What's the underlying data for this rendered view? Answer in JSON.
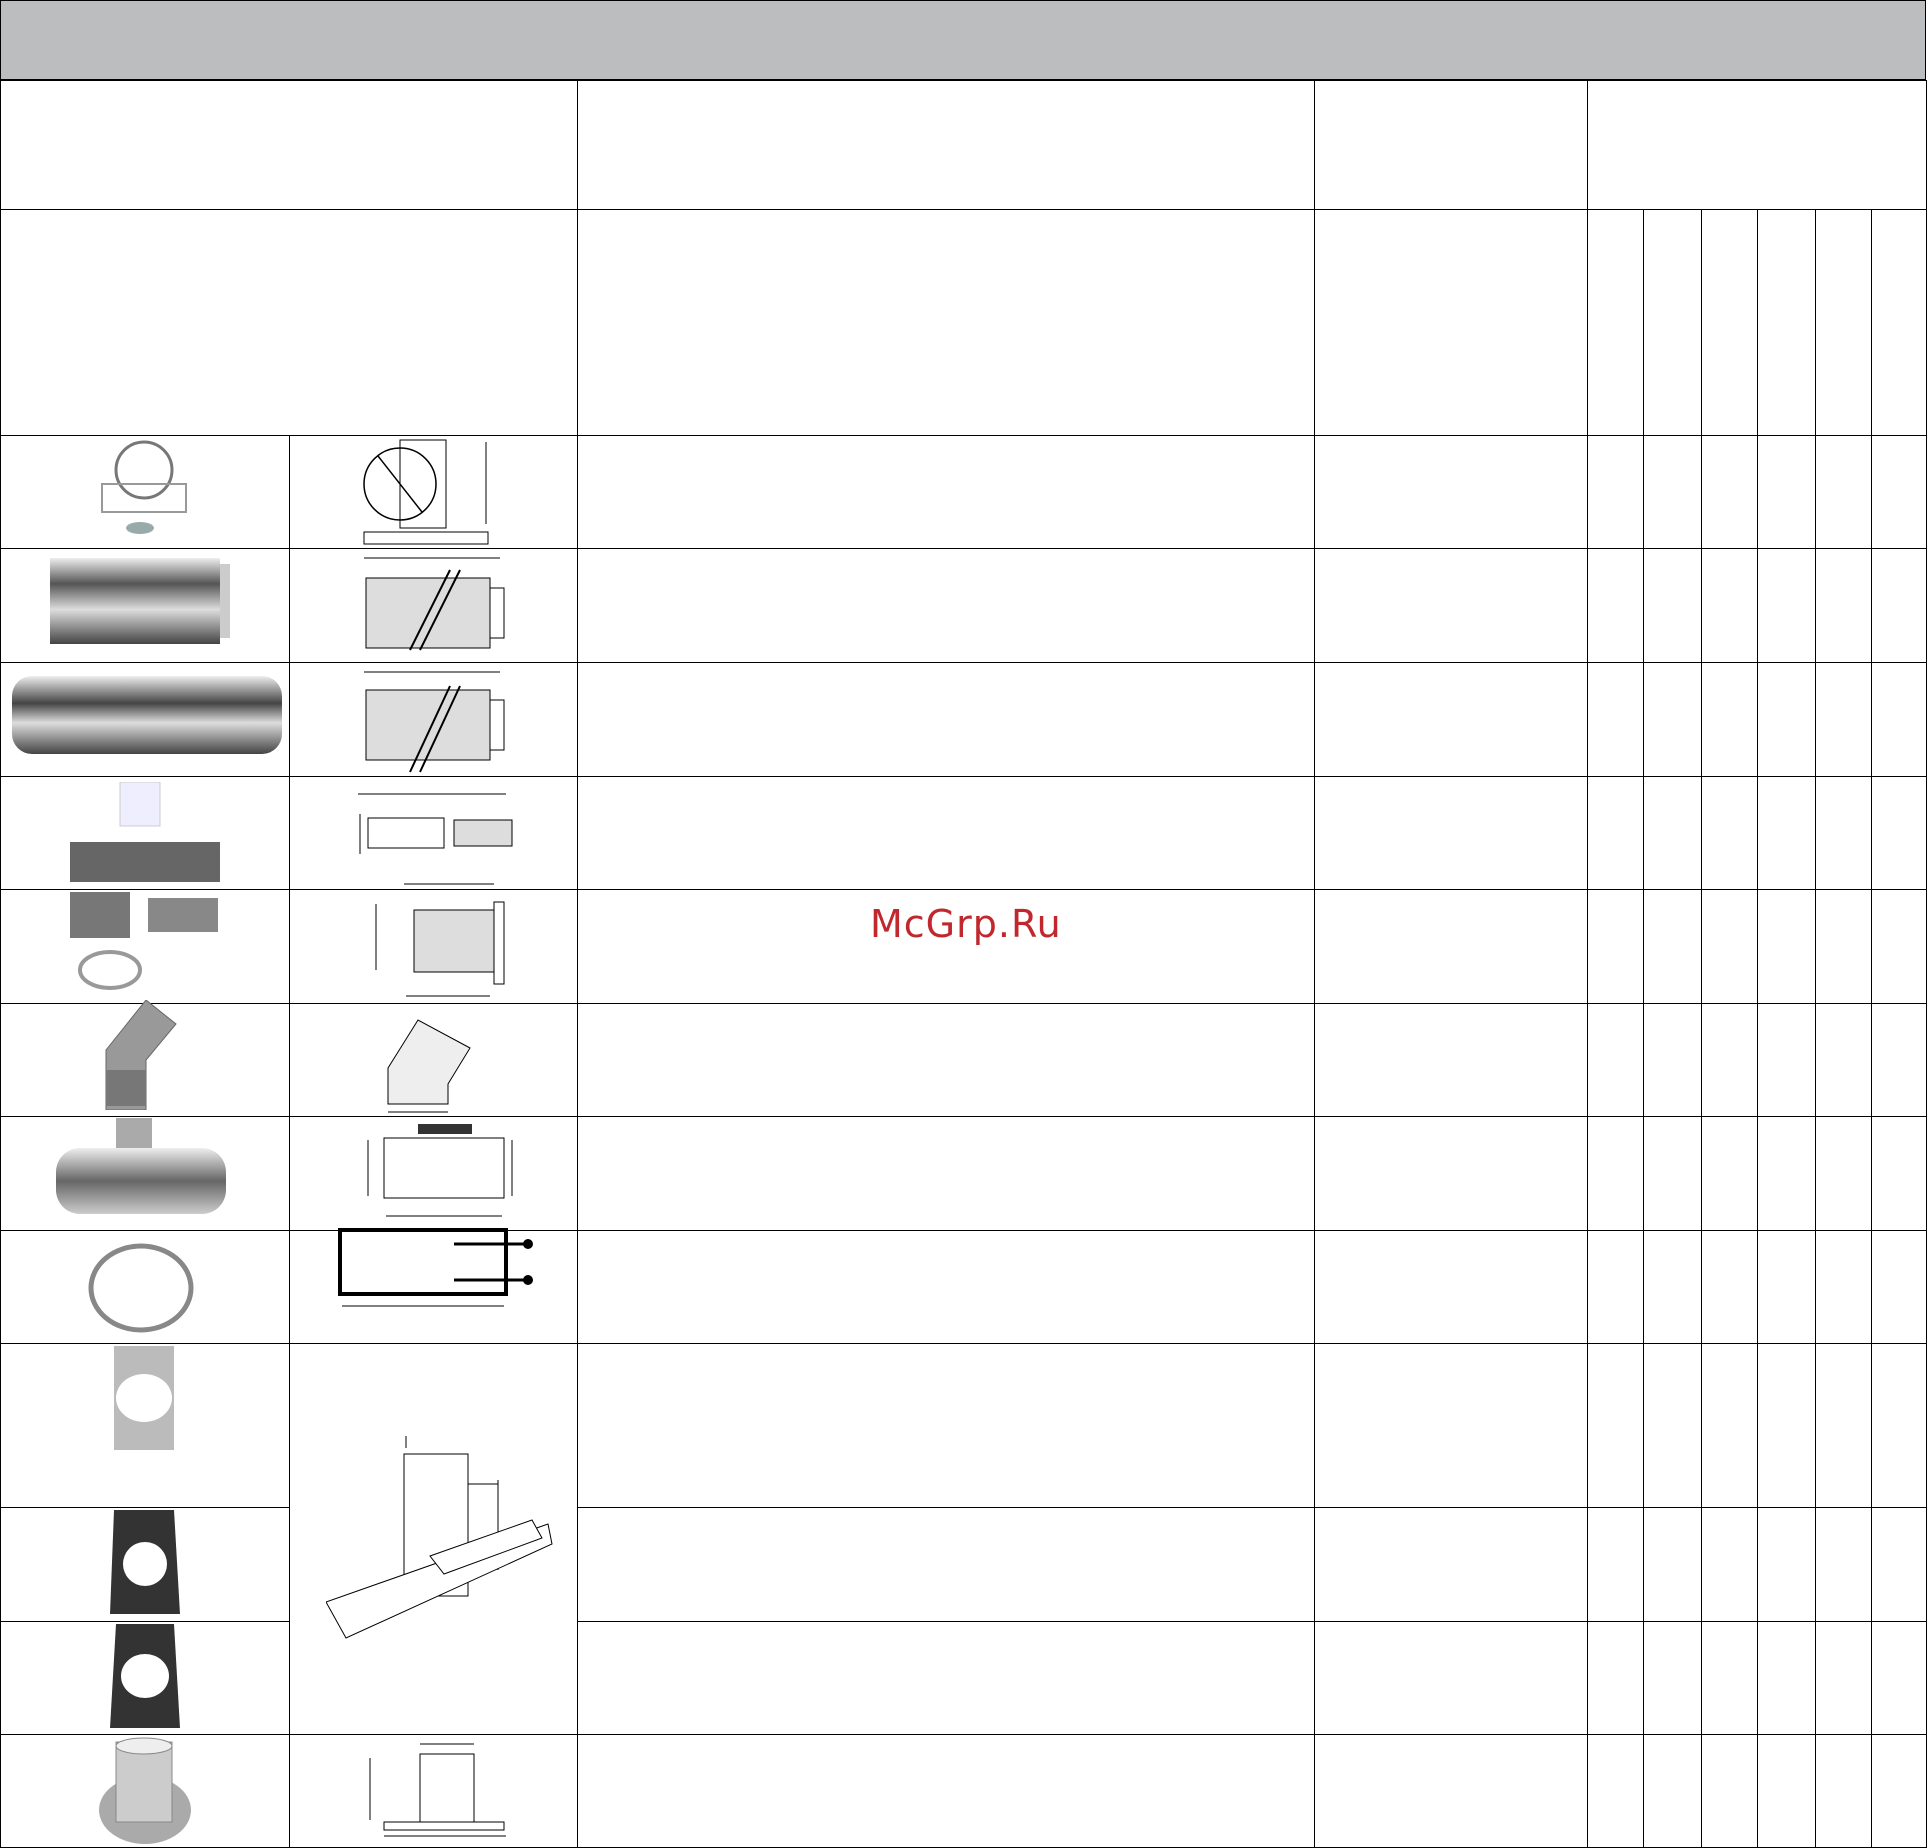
{
  "watermark": {
    "text": "McGrp.Ru",
    "color": "#c0282d"
  },
  "header_band_color": "#bcbdbf",
  "rows": [
    {
      "photo_icon": "wall-bracket-icon",
      "drawing_icon": "wall-bracket-drawing-icon"
    },
    {
      "photo_icon": "pipe-section-short-icon",
      "drawing_icon": "pipe-section-short-drawing-icon"
    },
    {
      "photo_icon": "pipe-section-long-icon",
      "drawing_icon": "pipe-section-long-drawing-icon"
    },
    {
      "photo_icon": "telescopic-pipe-kit-icon",
      "drawing_icon": "telescopic-pipe-drawing-icon"
    },
    {
      "photo_icon": "pipe-adapter-kit-icon",
      "drawing_icon": "adapter-drawing-icon"
    },
    {
      "photo_icon": "elbow-45-icon",
      "drawing_icon": "elbow-drawing-icon"
    },
    {
      "photo_icon": "tee-piece-icon",
      "drawing_icon": "tee-drawing-icon"
    },
    {
      "photo_icon": "pipe-clamp-icon",
      "drawing_icon": "clamp-drawing-icon"
    },
    {
      "photo_icon": "roof-flashing-flat-icon",
      "drawing_icon": "roof-flashing-drawing-icon"
    },
    {
      "photo_icon": "roof-flashing-pitched-icon",
      "drawing_icon": ""
    },
    {
      "photo_icon": "roof-flashing-pitched-alt-icon",
      "drawing_icon": ""
    },
    {
      "photo_icon": "roof-terminal-collar-icon",
      "drawing_icon": "terminal-collar-drawing-icon"
    }
  ]
}
